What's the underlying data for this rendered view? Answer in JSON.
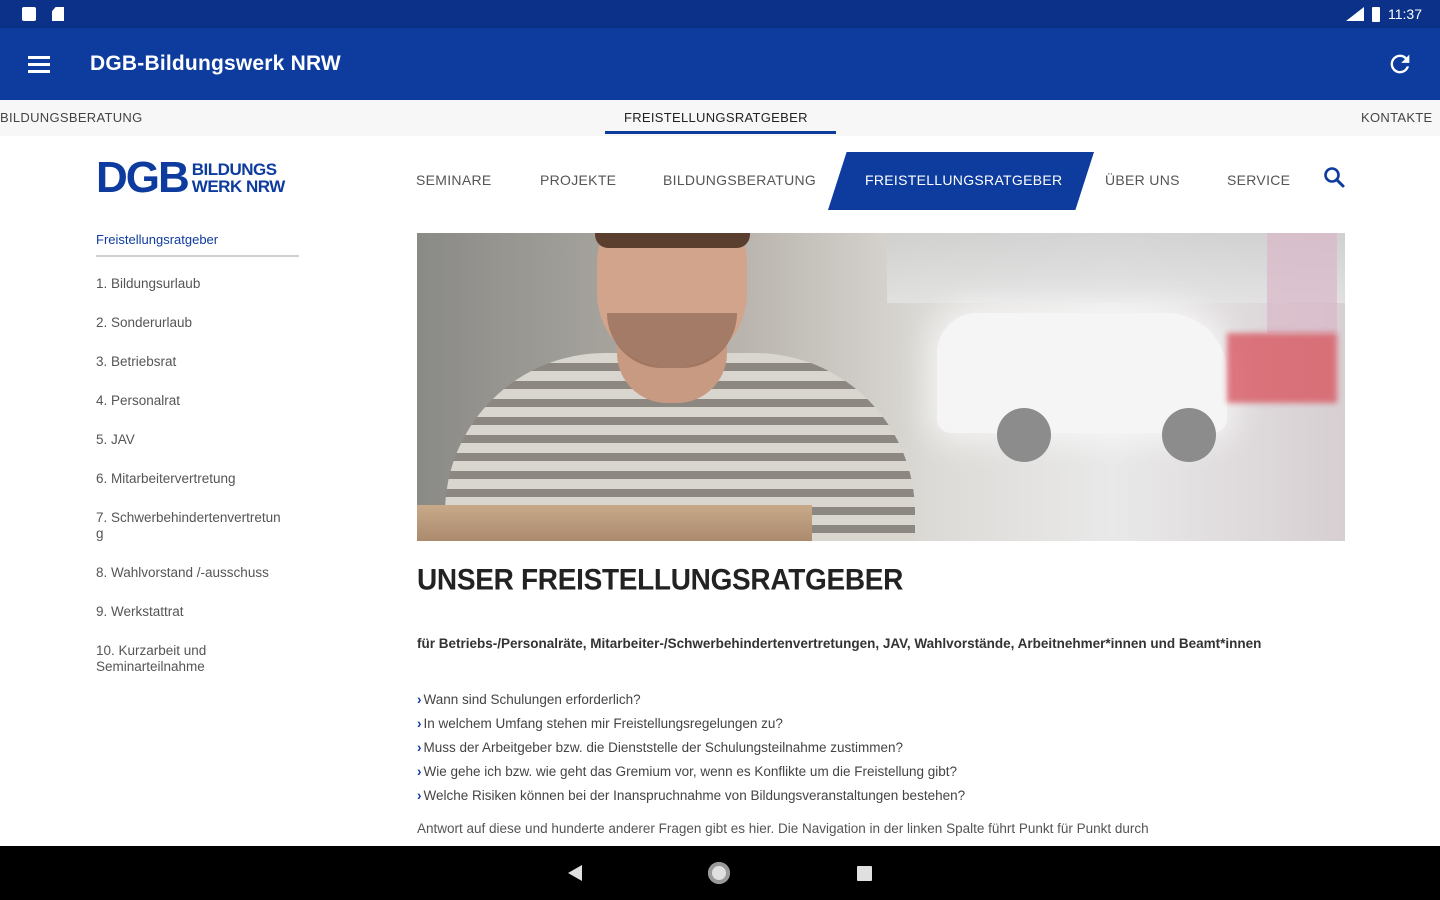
{
  "status_bar": {
    "time": "11:37"
  },
  "app_bar": {
    "title": "DGB-Bildungswerk NRW"
  },
  "tabs": [
    {
      "label": "BILDUNGSBERATUNG"
    },
    {
      "label": "FREISTELLUNGSRATGEBER"
    },
    {
      "label": "KONTAKTE"
    }
  ],
  "logo": {
    "main": "DGB",
    "line1": "BILDUNGS",
    "line2": "WERK NRW"
  },
  "main_nav": [
    {
      "label": "SEMINARE"
    },
    {
      "label": "PROJEKTE"
    },
    {
      "label": "BILDUNGSBERATUNG"
    },
    {
      "label": "FREISTELLUNGSRATGEBER"
    },
    {
      "label": "ÜBER UNS"
    },
    {
      "label": "SERVICE"
    }
  ],
  "sidebar": {
    "heading": "Freistellungsratgeber",
    "items": [
      "1. Bildungsurlaub",
      "2. Sonderurlaub",
      "3. Betriebsrat",
      "4. Personalrat",
      "5. JAV",
      "6. Mitarbeitervertretung",
      "7. Schwerbehindertenvertretung",
      "8. Wahlvorstand /-ausschuss",
      "9. Werkstattrat",
      "10. Kurzarbeit und Seminarteilnahme"
    ]
  },
  "content": {
    "title": "UNSER FREISTELLUNGSRATGEBER",
    "intro": "für Betriebs-/Personalräte, Mitarbeiter-/Schwerbehindertenvertretungen, JAV, Wahlvorstände, Arbeitnehmer*innen und Beamt*innen",
    "questions": [
      "Wann sind Schulungen erforderlich?",
      "In welchem Umfang stehen mir Freistellungsregelungen zu?",
      "Muss der Arbeitgeber bzw. die Dienststelle der Schulungsteilnahme zustimmen?",
      "Wie gehe ich bzw. wie geht das Gremium vor, wenn es Konflikte um die Freistellung gibt?",
      "Welche Risiken können bei der Inanspruchnahme von Bildungsveranstaltungen bestehen?"
    ],
    "answer": "Antwort auf diese und hunderte anderer Fragen gibt es hier. Die Navigation in der linken Spalte führt Punkt für Punkt durch"
  }
}
